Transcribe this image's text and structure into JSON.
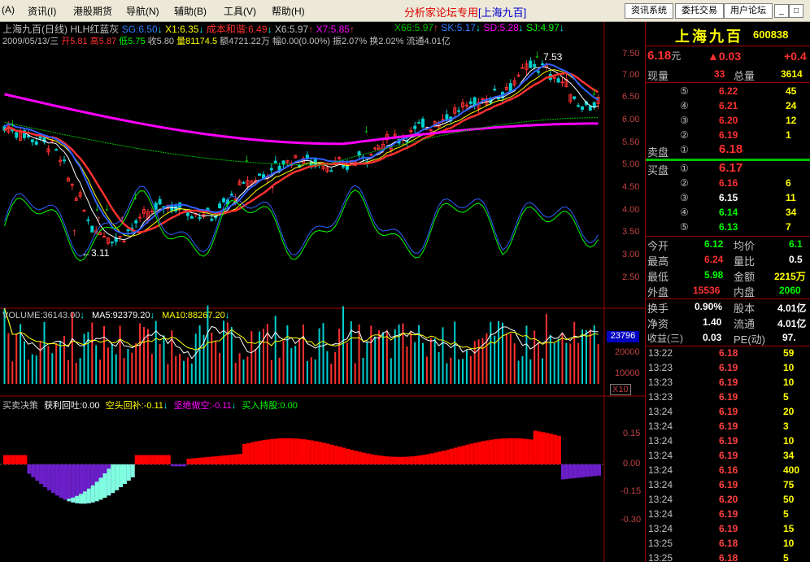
{
  "menu": {
    "items": [
      "资讯(I)",
      "港股期货",
      "导航(N)",
      "辅助(B)",
      "工具(V)",
      "帮助(H)"
    ],
    "title": "分析家论坛专用",
    "stock_tag": "[上海九百]",
    "buttons": [
      "资讯系统",
      "委托交易",
      "用户论坛"
    ],
    "winbtns": [
      "_",
      "□",
      "x"
    ]
  },
  "header": {
    "line1": {
      "name": "上海九百(日线)",
      "indicator": "HLH红蓝灰",
      "sg": "SG:6.50",
      "x1": "X1:6.35",
      "cost": "成本和谐:6.49",
      "x6": "X6:5.97",
      "x7": "X7:5.85",
      "x66": "X66:5.97",
      "sk": "SK:5.17",
      "sd": "SD:5.28",
      "sj": "SJ:4.97"
    },
    "line2": {
      "date": "2009/05/13/三",
      "open": "开5.81",
      "high": "高5.87",
      "low": "低5.75",
      "close": "收5.80",
      "volume": "量81174.5",
      "amount": "额4721.22万",
      "change": "幅0.00(0.00%)",
      "amplitude": "振2.07%",
      "turnover": "换2.02%",
      "float": "流通4.01亿"
    }
  },
  "price_axis": [
    "7.50",
    "7.00",
    "6.50",
    "6.00",
    "5.50",
    "5.00",
    "4.50",
    "4.00",
    "3.50",
    "3.00",
    "2.50"
  ],
  "annotations": {
    "high": "7.53",
    "low": "3.11"
  },
  "volume_pane": {
    "legend": "VOLUME:36143.00",
    "ma5": "MA5:92379.20",
    "ma10": "MA10:88267.20",
    "axis": [
      "20000",
      "10000"
    ],
    "current": "23796",
    "unit": "X10"
  },
  "signal_pane": {
    "legend": "买卖决策",
    "profit": "获利回吐:0.00",
    "short_cover": "空头回补:-0.11",
    "sell": "坚绝做空:-0.11",
    "buy": "买入持股:0.00",
    "axis": [
      "0.15",
      "0.00",
      "-0.15",
      "-0.30"
    ]
  },
  "quote": {
    "name": "上海九百",
    "code": "600838",
    "price": "6.18",
    "price_unit": "元",
    "change": "▲0.03",
    "change_pct": "+0.4",
    "now_vol_label": "现量",
    "now_vol": "33",
    "total_vol_label": "总量",
    "total_vol": "3614",
    "sell_label": "卖盘",
    "buy_label": "买盘",
    "asks": [
      {
        "lvl": "⑤",
        "price": "6.22",
        "vol": "45"
      },
      {
        "lvl": "④",
        "price": "6.21",
        "vol": "24"
      },
      {
        "lvl": "③",
        "price": "6.20",
        "vol": "12"
      },
      {
        "lvl": "②",
        "price": "6.19",
        "vol": "1"
      },
      {
        "lvl": "①",
        "price": "6.18",
        "vol": ""
      }
    ],
    "bids": [
      {
        "lvl": "①",
        "price": "6.17",
        "vol": ""
      },
      {
        "lvl": "②",
        "price": "6.16",
        "vol": "6"
      },
      {
        "lvl": "③",
        "price": "6.15",
        "vol": "11"
      },
      {
        "lvl": "④",
        "price": "6.14",
        "vol": "34"
      },
      {
        "lvl": "⑤",
        "price": "6.13",
        "vol": "7"
      }
    ],
    "stats": [
      {
        "l1": "今开",
        "v1": "6.12",
        "l2": "均价",
        "v2": "6.1"
      },
      {
        "l1": "最高",
        "v1": "6.24",
        "l2": "量比",
        "v2": "0.5"
      },
      {
        "l1": "最低",
        "v1": "5.98",
        "l2": "金额",
        "v2": "2215万"
      },
      {
        "l1": "外盘",
        "v1": "15536",
        "l2": "内盘",
        "v2": "2060"
      }
    ],
    "stats2": [
      {
        "l1": "换手",
        "v1": "0.90%",
        "l2": "股本",
        "v2": "4.01亿"
      },
      {
        "l1": "净资",
        "v1": "1.40",
        "l2": "流通",
        "v2": "4.01亿"
      },
      {
        "l1": "收益(三)",
        "v1": "0.03",
        "l2": "PE(动)",
        "v2": "97."
      }
    ],
    "ticks": [
      {
        "t": "13:22",
        "p": "6.18",
        "v": "59"
      },
      {
        "t": "13:23",
        "p": "6.19",
        "v": "10"
      },
      {
        "t": "13:23",
        "p": "6.19",
        "v": "10"
      },
      {
        "t": "13:23",
        "p": "6.19",
        "v": "5"
      },
      {
        "t": "13:24",
        "p": "6.19",
        "v": "20"
      },
      {
        "t": "13:24",
        "p": "6.19",
        "v": "3"
      },
      {
        "t": "13:24",
        "p": "6.19",
        "v": "10"
      },
      {
        "t": "13:24",
        "p": "6.19",
        "v": "34"
      },
      {
        "t": "13:24",
        "p": "6.16",
        "v": "400"
      },
      {
        "t": "13:24",
        "p": "6.19",
        "v": "75"
      },
      {
        "t": "13:24",
        "p": "6.20",
        "v": "50"
      },
      {
        "t": "13:24",
        "p": "6.19",
        "v": "5"
      },
      {
        "t": "13:24",
        "p": "6.19",
        "v": "15"
      },
      {
        "t": "13:25",
        "p": "6.18",
        "v": "10"
      },
      {
        "t": "13:25",
        "p": "6.18",
        "v": "5"
      }
    ]
  },
  "colors": {
    "up": "#ff3030",
    "down": "#00d0d0",
    "ma_white": "#ffffff",
    "ma_yellow": "#ffff00",
    "magenta": "#ff00ff",
    "green": "#00c000",
    "blue": "#3060ff"
  }
}
